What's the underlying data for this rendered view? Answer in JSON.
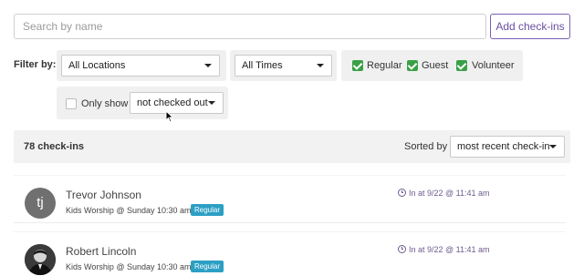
{
  "search": {
    "placeholder": "Search by name",
    "value": ""
  },
  "add_button": {
    "label": "Add check-ins"
  },
  "filters": {
    "label": "Filter by:",
    "location": "All Locations",
    "time": "All Times",
    "kinds": [
      {
        "label": "Regular",
        "checked": true
      },
      {
        "label": "Guest",
        "checked": true
      },
      {
        "label": "Volunteer",
        "checked": true
      }
    ],
    "only_show": {
      "label": "Only show",
      "checked": false,
      "value": "not checked out"
    }
  },
  "summary": {
    "count": "78 check-ins",
    "sorted_by_label": "Sorted by",
    "sort_value": "most recent check-in"
  },
  "checkins": [
    {
      "initials": "tj",
      "name": "Trevor Johnson",
      "event": "Kids Worship @ Sunday 10:30 am",
      "kind": "Regular",
      "status": "In at 9/22 @ 11:41 am",
      "avatar_icon": "initials"
    },
    {
      "initials": "",
      "name": "Robert Lincoln",
      "event": "Kids Worship @ Sunday 10:30 am",
      "kind": "Regular",
      "status": "In at 9/22 @ 11:41 am",
      "avatar_icon": "person-photo"
    }
  ],
  "colors": {
    "accent": "#6a4fa3",
    "check": "#3aa046",
    "badge": "#2c9fc4"
  }
}
